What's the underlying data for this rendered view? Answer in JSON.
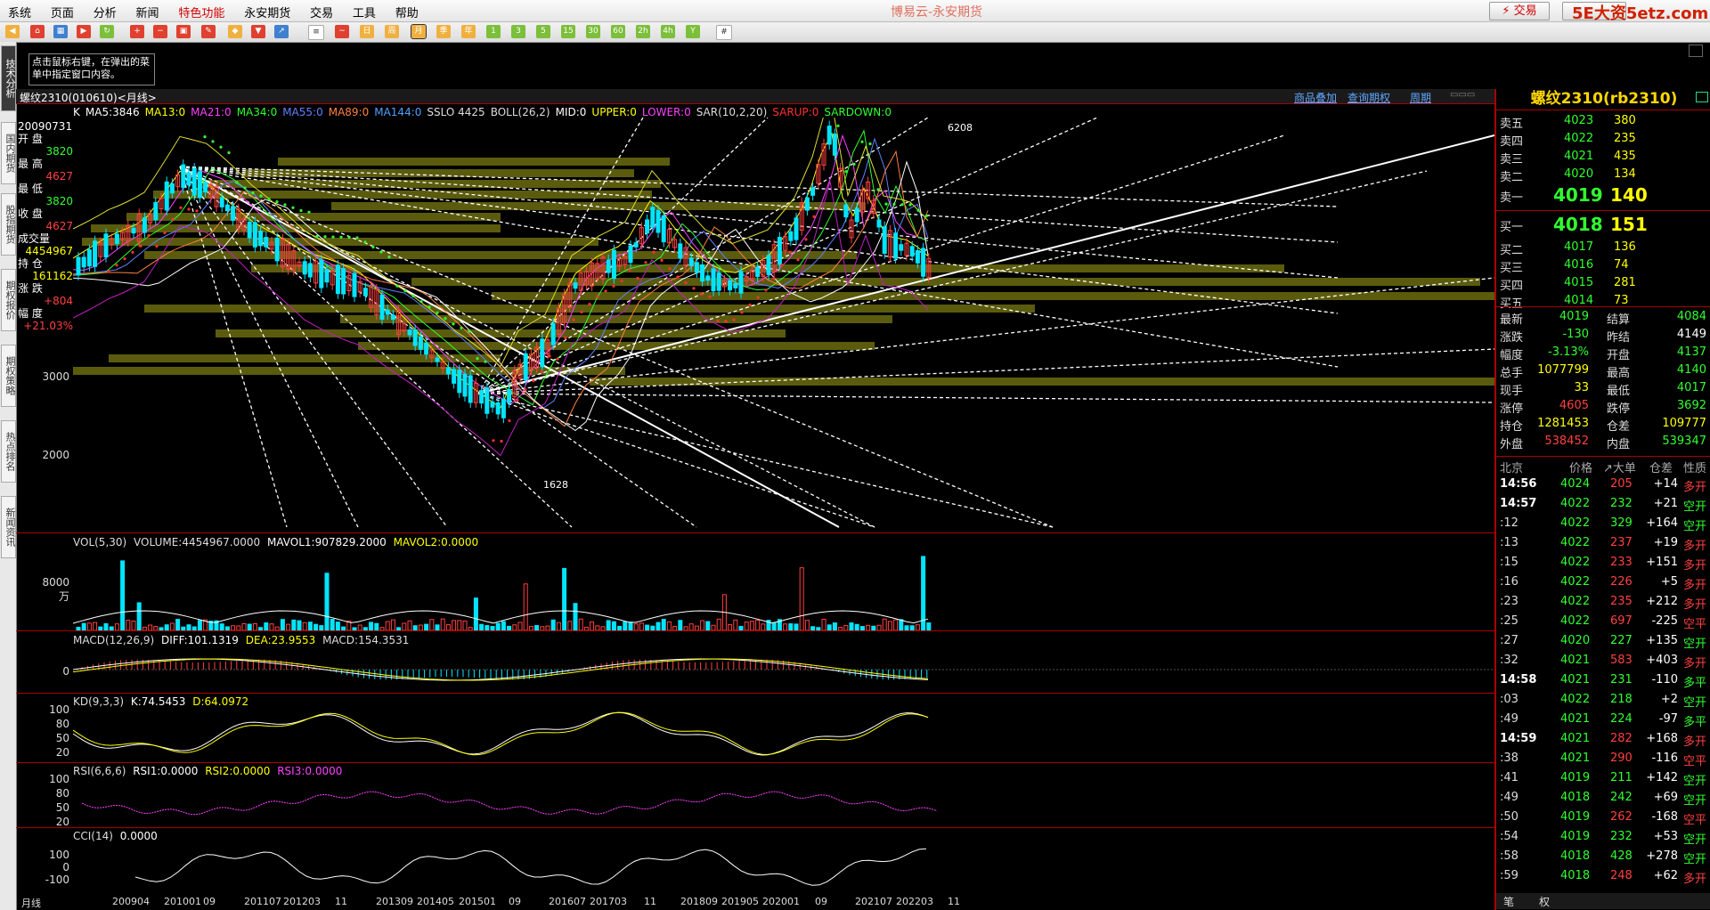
{
  "menu": [
    "系统",
    "页面",
    "分析",
    "新闻",
    "特色功能",
    "永安期货",
    "交易",
    "工具",
    "帮助"
  ],
  "app_title": "博易云-永安期货",
  "trade_button": "⚡ 交易",
  "watermark": "5E大资5etz.com",
  "tip_text": "点击鼠标右键，在弹出的菜单中指定窗口内容。",
  "left_tabs": [
    "技术分析",
    "国内期货",
    "股指期货",
    "期权报价",
    "期权策略",
    "热点排名",
    "新闻资讯"
  ],
  "chart_header": {
    "symbol": "螺纹2310(010610)<月线>",
    "links": [
      "商品叠加",
      "查询期权",
      "周期"
    ]
  },
  "legend": [
    {
      "t": "K",
      "c": "#ffffff"
    },
    {
      "t": "MA5:3846",
      "c": "#ffffff"
    },
    {
      "t": "MA13:0",
      "c": "#ffff00"
    },
    {
      "t": "MA21:0",
      "c": "#ff40ff"
    },
    {
      "t": "MA34:0",
      "c": "#30ff30"
    },
    {
      "t": "MA55:0",
      "c": "#6080ff"
    },
    {
      "t": "MA89:0",
      "c": "#ff8040"
    },
    {
      "t": "MA144:0",
      "c": "#50a0ff"
    },
    {
      "t": "SSLO 4425",
      "c": "#dddddd"
    },
    {
      "t": "BOLL(26,2)",
      "c": "#dddddd"
    },
    {
      "t": "MID:0",
      "c": "#ffffff"
    },
    {
      "t": "UPPER:0",
      "c": "#ffff00"
    },
    {
      "t": "LOWER:0",
      "c": "#ff40ff"
    },
    {
      "t": "SAR(10,2,20)",
      "c": "#dddddd"
    },
    {
      "t": "SARUP:0",
      "c": "#ff3030"
    },
    {
      "t": "SARDOWN:0",
      "c": "#30ff30"
    }
  ],
  "info_panel": [
    {
      "t": "20090731",
      "c": "#ffffff"
    },
    {
      "t": "开  盘",
      "c": "#ffffff"
    },
    {
      "t": "3820",
      "c": "#30ff30"
    },
    {
      "t": "最  高",
      "c": "#ffffff"
    },
    {
      "t": "4627",
      "c": "#ff4040"
    },
    {
      "t": "最  低",
      "c": "#ffffff"
    },
    {
      "t": "3820",
      "c": "#30ff30"
    },
    {
      "t": "收  盘",
      "c": "#ffffff"
    },
    {
      "t": "4627",
      "c": "#ff4040"
    },
    {
      "t": "成交量",
      "c": "#ffffff"
    },
    {
      "t": "4454967",
      "c": "#ffff00"
    },
    {
      "t": "持  仓",
      "c": "#ffffff"
    },
    {
      "t": "161162",
      "c": "#ffff00"
    },
    {
      "t": "涨  跌",
      "c": "#ffffff"
    },
    {
      "t": "+804",
      "c": "#ff4040"
    },
    {
      "t": "幅  度",
      "c": "#ffffff"
    },
    {
      "t": "+21.03%",
      "c": "#ff4040"
    }
  ],
  "price_axis": [
    "3000",
    "2000"
  ],
  "price_annotations": {
    "high": "6208",
    "low": "1628"
  },
  "vol": {
    "label": "VOL(5,30)",
    "volume": "VOLUME:4454967.0000",
    "mavol1": "MAVOL1:907829.2000",
    "mavol2": "MAVOL2:0.0000",
    "axis": "8000万"
  },
  "macd": {
    "label": "MACD(12,26,9)",
    "diff": "DIFF:101.1319",
    "dea": "DEA:23.9553",
    "macd": "MACD:154.3531",
    "axis": "0"
  },
  "kd": {
    "label": "KD(9,3,3)",
    "k": "K:74.5453",
    "d": "D:64.0972",
    "axis": [
      "100",
      "80",
      "50",
      "20"
    ]
  },
  "rsi": {
    "label": "RSI(6,6,6)",
    "r1": "RSI1:0.0000",
    "r2": "RSI2:0.0000",
    "r3": "RSI3:0.0000",
    "axis": [
      "100",
      "80",
      "50",
      "20"
    ]
  },
  "cci": {
    "label": "CCI(14)",
    "value": "0.0000",
    "axis": [
      "100",
      "0",
      "-100"
    ]
  },
  "x_axis": [
    "月线",
    "200904",
    "201001",
    "09",
    "201107",
    "201203",
    "11",
    "201309",
    "201405",
    "201501",
    "09",
    "201607",
    "201703",
    "11",
    "201809",
    "201905",
    "202001",
    "09",
    "202107",
    "202203",
    "11"
  ],
  "quote": {
    "title": "螺纹2310(rb2310)",
    "asks": [
      {
        "l": "卖五",
        "p": "4023",
        "v": "380"
      },
      {
        "l": "卖四",
        "p": "4022",
        "v": "235"
      },
      {
        "l": "卖三",
        "p": "4021",
        "v": "435"
      },
      {
        "l": "卖二",
        "p": "4020",
        "v": "134"
      }
    ],
    "ask1": {
      "l": "卖一",
      "p": "4019",
      "v": "140"
    },
    "bid1": {
      "l": "买一",
      "p": "4018",
      "v": "151"
    },
    "bids": [
      {
        "l": "买二",
        "p": "4017",
        "v": "136"
      },
      {
        "l": "买三",
        "p": "4016",
        "v": "74"
      },
      {
        "l": "买四",
        "p": "4015",
        "v": "281"
      },
      {
        "l": "买五",
        "p": "4014",
        "v": "73"
      }
    ],
    "stats": [
      {
        "a": "最新",
        "av": "4019",
        "ac": "#30ff30",
        "b": "结算",
        "bv": "4084",
        "bc": "#30ff30"
      },
      {
        "a": "涨跌",
        "av": "-130",
        "ac": "#30ff30",
        "b": "昨结",
        "bv": "4149",
        "bc": "#ffffff"
      },
      {
        "a": "幅度",
        "av": "-3.13%",
        "ac": "#30ff30",
        "b": "开盘",
        "bv": "4137",
        "bc": "#30ff30"
      },
      {
        "a": "总手",
        "av": "1077799",
        "ac": "#ffff00",
        "b": "最高",
        "bv": "4140",
        "bc": "#30ff30"
      },
      {
        "a": "现手",
        "av": "33",
        "ac": "#ffff00",
        "b": "最低",
        "bv": "4017",
        "bc": "#30ff30"
      },
      {
        "a": "涨停",
        "av": "4605",
        "ac": "#ff4040",
        "b": "跌停",
        "bv": "3692",
        "bc": "#30ff30"
      },
      {
        "a": "持仓",
        "av": "1281453",
        "ac": "#ffff00",
        "b": "仓差",
        "bv": "109777",
        "bc": "#ffff00"
      },
      {
        "a": "外盘",
        "av": "538452",
        "ac": "#ff4040",
        "b": "内盘",
        "bv": "539347",
        "bc": "#30ff30"
      }
    ],
    "ticks_header": [
      "北京",
      "价格",
      "↗大单",
      "仓差",
      "性质"
    ],
    "ticks": [
      {
        "t": "14:56",
        "p": "4024",
        "v": "205",
        "d": "+14",
        "k": "多开",
        "kc": "#ff4040",
        "vc": "#ff4040"
      },
      {
        "t": "14:57",
        "p": "4022",
        "v": "232",
        "d": "+21",
        "k": "空开",
        "kc": "#30ff30",
        "vc": "#30ff30"
      },
      {
        "t": ":12",
        "p": "4022",
        "v": "329",
        "d": "+164",
        "k": "空开",
        "kc": "#30ff30",
        "vc": "#30ff30"
      },
      {
        "t": ":13",
        "p": "4022",
        "v": "237",
        "d": "+19",
        "k": "多开",
        "kc": "#ff4040",
        "vc": "#ff4040"
      },
      {
        "t": ":15",
        "p": "4022",
        "v": "233",
        "d": "+151",
        "k": "多开",
        "kc": "#ff4040",
        "vc": "#ff4040"
      },
      {
        "t": ":16",
        "p": "4022",
        "v": "226",
        "d": "+5",
        "k": "多开",
        "kc": "#ff4040",
        "vc": "#ff4040"
      },
      {
        "t": ":23",
        "p": "4022",
        "v": "235",
        "d": "+212",
        "k": "多开",
        "kc": "#ff4040",
        "vc": "#ff4040"
      },
      {
        "t": ":25",
        "p": "4022",
        "v": "697",
        "d": "-225",
        "k": "空平",
        "kc": "#ff4040",
        "vc": "#ff4040"
      },
      {
        "t": ":27",
        "p": "4020",
        "v": "227",
        "d": "+135",
        "k": "空开",
        "kc": "#30ff30",
        "vc": "#30ff30"
      },
      {
        "t": ":32",
        "p": "4021",
        "v": "583",
        "d": "+403",
        "k": "多开",
        "kc": "#ff4040",
        "vc": "#ff4040"
      },
      {
        "t": "14:58",
        "p": "4021",
        "v": "231",
        "d": "-110",
        "k": "多平",
        "kc": "#30ff30",
        "vc": "#30ff30"
      },
      {
        "t": ":03",
        "p": "4022",
        "v": "218",
        "d": "+2",
        "k": "空开",
        "kc": "#30ff30",
        "vc": "#30ff30"
      },
      {
        "t": ":49",
        "p": "4021",
        "v": "224",
        "d": "-97",
        "k": "多平",
        "kc": "#30ff30",
        "vc": "#30ff30"
      },
      {
        "t": "14:59",
        "p": "4021",
        "v": "282",
        "d": "+168",
        "k": "多开",
        "kc": "#ff4040",
        "vc": "#ff4040"
      },
      {
        "t": ":38",
        "p": "4021",
        "v": "290",
        "d": "-116",
        "k": "空平",
        "kc": "#ff4040",
        "vc": "#ff4040"
      },
      {
        "t": ":41",
        "p": "4019",
        "v": "211",
        "d": "+142",
        "k": "空开",
        "kc": "#30ff30",
        "vc": "#30ff30"
      },
      {
        "t": ":49",
        "p": "4018",
        "v": "242",
        "d": "+69",
        "k": "空开",
        "kc": "#30ff30",
        "vc": "#30ff30"
      },
      {
        "t": ":50",
        "p": "4019",
        "v": "262",
        "d": "-168",
        "k": "空平",
        "kc": "#ff4040",
        "vc": "#ff4040"
      },
      {
        "t": ":54",
        "p": "4019",
        "v": "232",
        "d": "+53",
        "k": "空开",
        "kc": "#30ff30",
        "vc": "#30ff30"
      },
      {
        "t": ":58",
        "p": "4018",
        "v": "428",
        "d": "+278",
        "k": "空开",
        "kc": "#30ff30",
        "vc": "#30ff30"
      },
      {
        "t": ":59",
        "p": "4018",
        "v": "248",
        "d": "+62",
        "k": "多开",
        "kc": "#ff4040",
        "vc": "#ff4040"
      }
    ],
    "bottom_tabs": [
      "笔",
      "权"
    ]
  },
  "colors": {
    "up": "#ff4040",
    "down": "#00e5ff",
    "grid": "#a00000",
    "accent": "#ffd700"
  }
}
